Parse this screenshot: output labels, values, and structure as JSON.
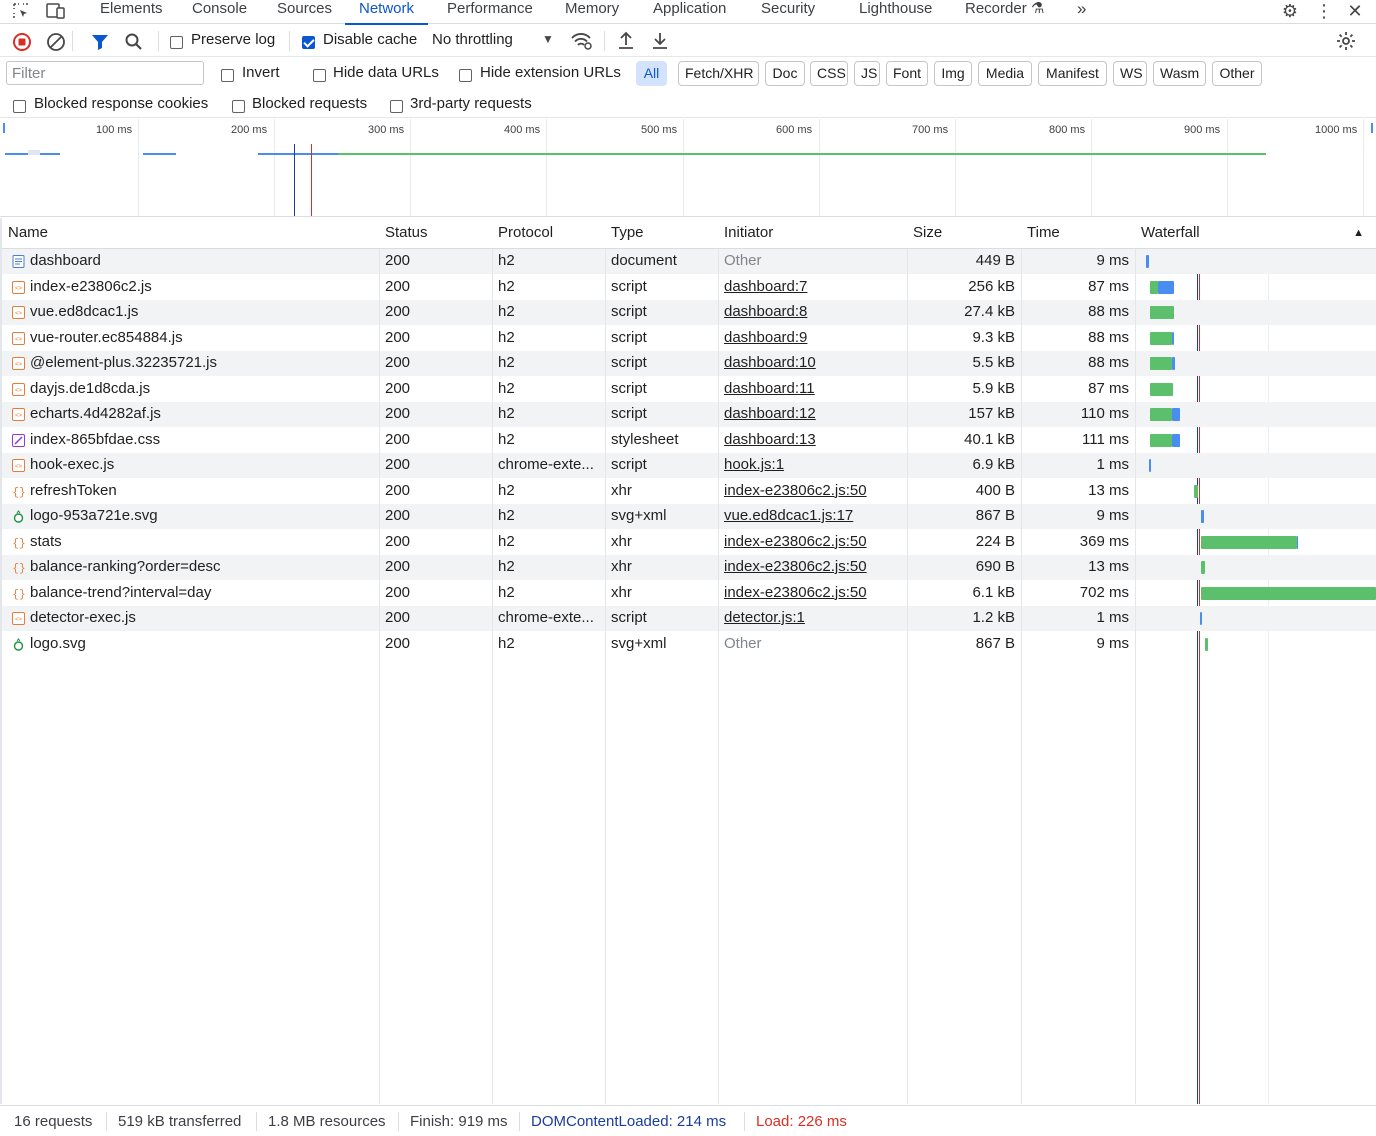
{
  "tabs": [
    "Elements",
    "Console",
    "Sources",
    "Network",
    "Performance",
    "Memory",
    "Application",
    "Security",
    "Lighthouse",
    "Recorder"
  ],
  "toolbar": {
    "preserve_log": "Preserve log",
    "disable_cache": "Disable cache",
    "throttling": "No throttling"
  },
  "filter": {
    "placeholder": "Filter",
    "invert": "Invert",
    "hide_data_urls": "Hide data URLs",
    "hide_extension_urls": "Hide extension URLs",
    "types": [
      "All",
      "Fetch/XHR",
      "Doc",
      "CSS",
      "JS",
      "Font",
      "Img",
      "Media",
      "Manifest",
      "WS",
      "Wasm",
      "Other"
    ]
  },
  "options": {
    "blocked_cookies": "Blocked response cookies",
    "blocked_requests": "Blocked requests",
    "third_party": "3rd-party requests"
  },
  "overview": {
    "ticks": [
      "100 ms",
      "200 ms",
      "300 ms",
      "400 ms",
      "500 ms",
      "600 ms",
      "700 ms",
      "800 ms",
      "900 ms",
      "1000 ms"
    ],
    "dom_content_loaded_ms": 214,
    "load_ms": 226
  },
  "table": {
    "columns": [
      "Name",
      "Status",
      "Protocol",
      "Type",
      "Initiator",
      "Size",
      "Time",
      "Waterfall"
    ],
    "rows": [
      {
        "name": "dashboard",
        "status": "200",
        "protocol": "h2",
        "type": "document",
        "initiator": "Other",
        "size": "449 B",
        "time": "9 ms",
        "icon": "document-icon"
      },
      {
        "name": "index-e23806c2.js",
        "status": "200",
        "protocol": "h2",
        "type": "script",
        "initiator": "dashboard:7",
        "size": "256 kB",
        "time": "87 ms",
        "icon": "script-icon"
      },
      {
        "name": "vue.ed8dcac1.js",
        "status": "200",
        "protocol": "h2",
        "type": "script",
        "initiator": "dashboard:8",
        "size": "27.4 kB",
        "time": "88 ms",
        "icon": "script-icon"
      },
      {
        "name": "vue-router.ec854884.js",
        "status": "200",
        "protocol": "h2",
        "type": "script",
        "initiator": "dashboard:9",
        "size": "9.3 kB",
        "time": "88 ms",
        "icon": "script-icon"
      },
      {
        "name": "@element-plus.32235721.js",
        "status": "200",
        "protocol": "h2",
        "type": "script",
        "initiator": "dashboard:10",
        "size": "5.5 kB",
        "time": "88 ms",
        "icon": "script-icon"
      },
      {
        "name": "dayjs.de1d8cda.js",
        "status": "200",
        "protocol": "h2",
        "type": "script",
        "initiator": "dashboard:11",
        "size": "5.9 kB",
        "time": "87 ms",
        "icon": "script-icon"
      },
      {
        "name": "echarts.4d4282af.js",
        "status": "200",
        "protocol": "h2",
        "type": "script",
        "initiator": "dashboard:12",
        "size": "157 kB",
        "time": "110 ms",
        "icon": "script-icon"
      },
      {
        "name": "index-865bfdae.css",
        "status": "200",
        "protocol": "h2",
        "type": "stylesheet",
        "initiator": "dashboard:13",
        "size": "40.1 kB",
        "time": "111 ms",
        "icon": "stylesheet-icon"
      },
      {
        "name": "hook-exec.js",
        "status": "200",
        "protocol": "chrome-exte...",
        "type": "script",
        "initiator": "hook.js:1",
        "size": "6.9 kB",
        "time": "1 ms",
        "icon": "script-icon"
      },
      {
        "name": "refreshToken",
        "status": "200",
        "protocol": "h2",
        "type": "xhr",
        "initiator": "index-e23806c2.js:50",
        "size": "400 B",
        "time": "13 ms",
        "icon": "xhr-icon"
      },
      {
        "name": "logo-953a721e.svg",
        "status": "200",
        "protocol": "h2",
        "type": "svg+xml",
        "initiator": "vue.ed8dcac1.js:17",
        "size": "867 B",
        "time": "9 ms",
        "icon": "image-icon"
      },
      {
        "name": "stats",
        "status": "200",
        "protocol": "h2",
        "type": "xhr",
        "initiator": "index-e23806c2.js:50",
        "size": "224 B",
        "time": "369 ms",
        "icon": "xhr-icon"
      },
      {
        "name": "balance-ranking?order=desc",
        "status": "200",
        "protocol": "h2",
        "type": "xhr",
        "initiator": "index-e23806c2.js:50",
        "size": "690 B",
        "time": "13 ms",
        "icon": "xhr-icon"
      },
      {
        "name": "balance-trend?interval=day",
        "status": "200",
        "protocol": "h2",
        "type": "xhr",
        "initiator": "index-e23806c2.js:50",
        "size": "6.1 kB",
        "time": "702 ms",
        "icon": "xhr-icon"
      },
      {
        "name": "detector-exec.js",
        "status": "200",
        "protocol": "chrome-exte...",
        "type": "script",
        "initiator": "detector.js:1",
        "size": "1.2 kB",
        "time": "1 ms",
        "icon": "script-icon"
      },
      {
        "name": "logo.svg",
        "status": "200",
        "protocol": "h2",
        "type": "svg+xml",
        "initiator": "Other",
        "size": "867 B",
        "time": "9 ms",
        "icon": "image-icon"
      }
    ]
  },
  "footer": {
    "requests": "16 requests",
    "transferred": "519 kB transferred",
    "resources": "1.8 MB resources",
    "finish": "Finish: 919 ms",
    "dcl": "DOMContentLoaded: 214 ms",
    "load": "Load: 226 ms"
  },
  "colors": {
    "accent": "#0b57d0",
    "waiting_green": "#5cbf6b",
    "download_blue": "#4a8df0",
    "dcl_blue": "#1a3d9e",
    "load_red": "#d93025"
  }
}
